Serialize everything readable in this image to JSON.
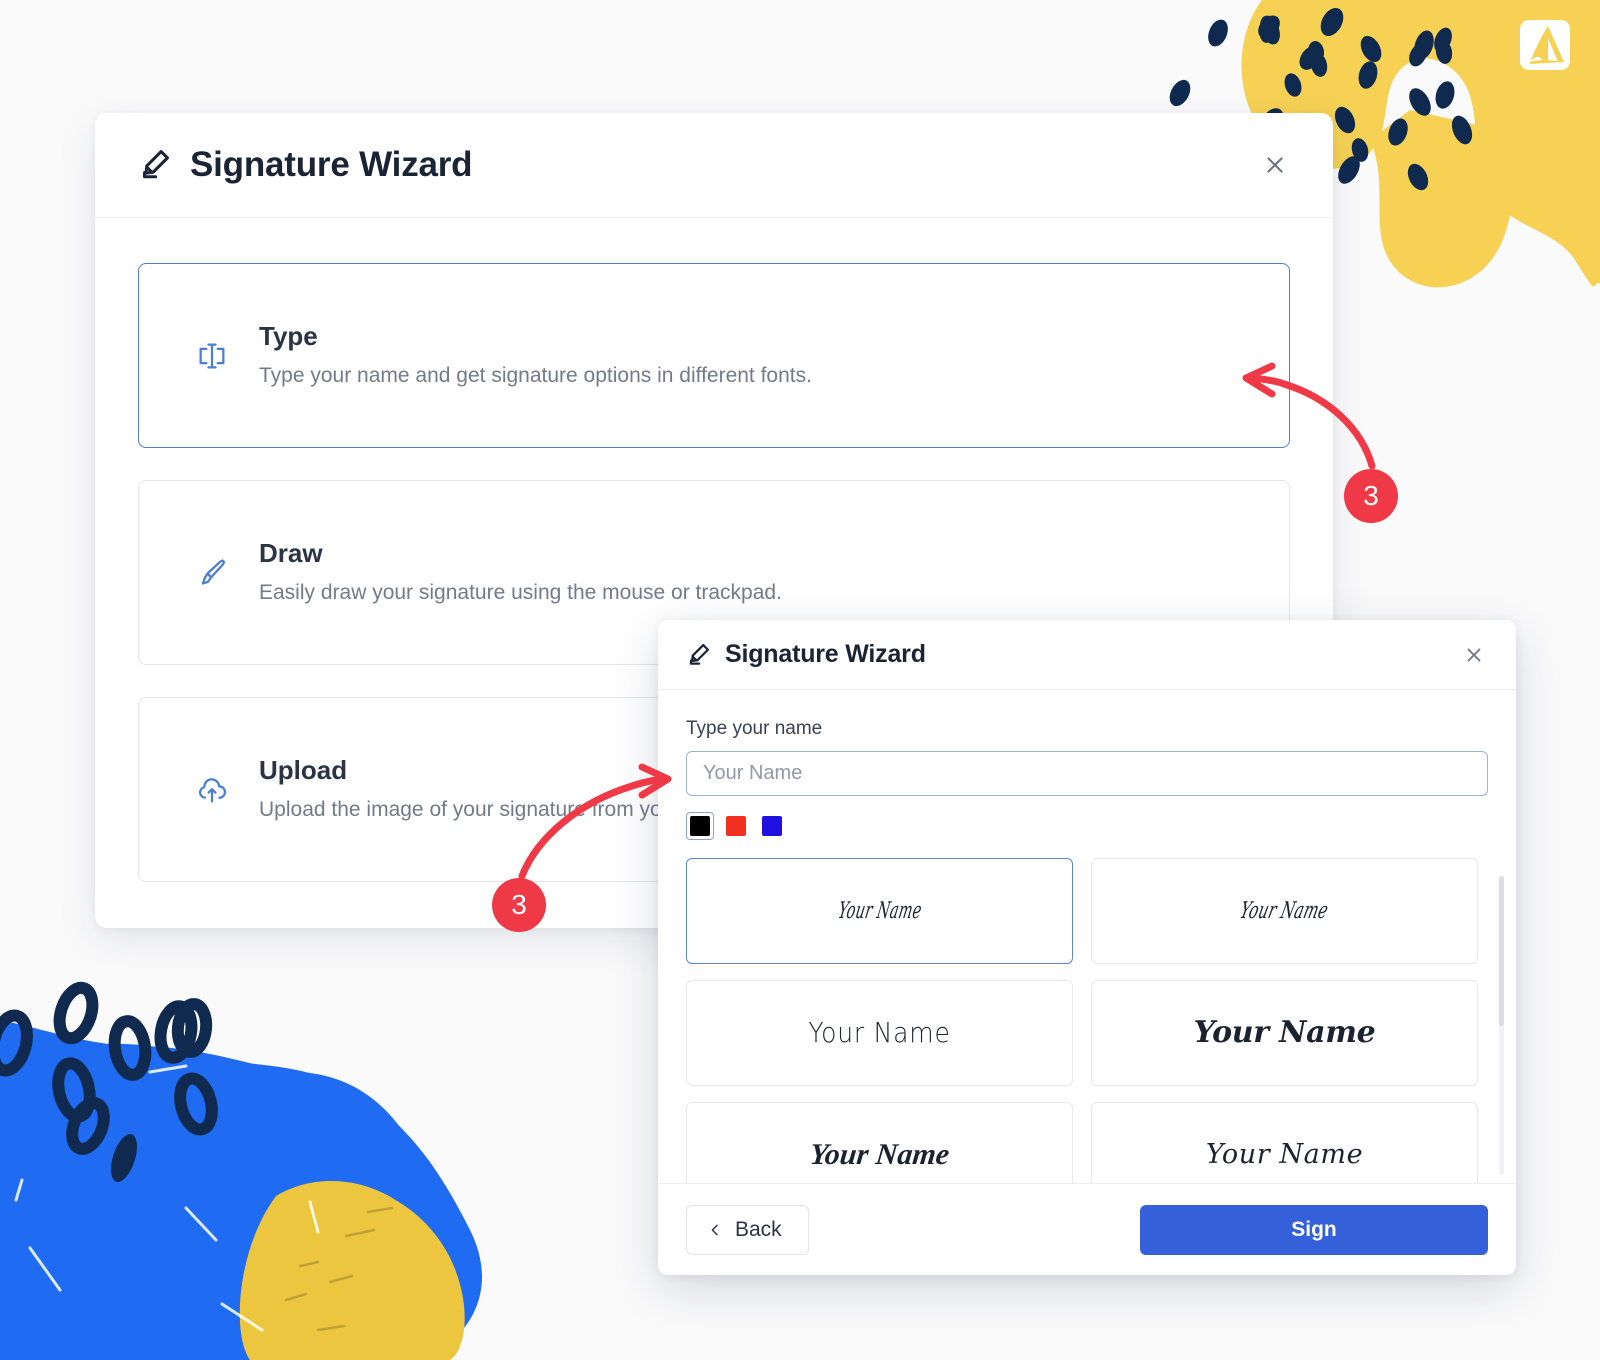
{
  "page": {
    "background_color": "#fafafb",
    "brand_logo_name": "acrobat-logo"
  },
  "decor": {
    "yellow": "#f6d154",
    "navy": "#102a4c",
    "blue": "#1f6bf2",
    "gold": "#ecc63f"
  },
  "primary_dialog": {
    "title": "Signature Wizard",
    "close_label": "×",
    "options": [
      {
        "id": "type",
        "icon": "text-cursor-icon",
        "title": "Type",
        "description": "Type your name and get signature options in different fonts.",
        "selected": true
      },
      {
        "id": "draw",
        "icon": "paintbrush-icon",
        "title": "Draw",
        "description": "Easily draw your signature using the mouse or trackpad.",
        "selected": false
      },
      {
        "id": "upload",
        "icon": "cloud-upload-icon",
        "title": "Upload",
        "description": "Upload the image of your signature from your device.",
        "selected": false
      }
    ]
  },
  "secondary_dialog": {
    "title": "Signature Wizard",
    "close_label": "×",
    "name_field": {
      "label": "Type your name",
      "value": "",
      "placeholder": "Your Name"
    },
    "colors": [
      {
        "name": "black",
        "hex": "#000000",
        "selected": true
      },
      {
        "name": "red",
        "hex": "#f03020",
        "selected": false
      },
      {
        "name": "blue",
        "hex": "#1f12e0",
        "selected": false
      }
    ],
    "signature_previews": [
      {
        "text": "Your Name",
        "style": "sig-f1",
        "selected": true
      },
      {
        "text": "Your Name",
        "style": "sig-f2",
        "selected": false
      },
      {
        "text": "Your Name",
        "style": "sig-f3",
        "selected": false
      },
      {
        "text": "Your Name",
        "style": "sig-f4",
        "selected": false
      },
      {
        "text": "Your Name",
        "style": "sig-f5",
        "selected": false
      },
      {
        "text": "Your Name",
        "style": "sig-f6",
        "selected": false
      }
    ],
    "footer": {
      "back_label": "Back",
      "sign_label": "Sign"
    }
  },
  "annotations": [
    {
      "id": "a",
      "number": "3",
      "points_to": "type-option-card"
    },
    {
      "id": "b",
      "number": "3",
      "points_to": "secondary-dialog"
    }
  ]
}
